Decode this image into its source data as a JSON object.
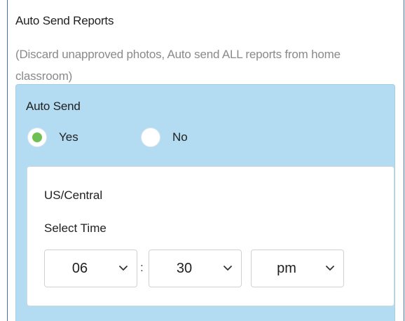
{
  "section": {
    "title": "Auto Send Reports",
    "description": "(Discard unapproved photos, Auto send ALL reports from home classroom)"
  },
  "auto_send": {
    "label": "Auto Send",
    "options": [
      {
        "label": "Yes",
        "selected": true
      },
      {
        "label": "No",
        "selected": false
      }
    ],
    "selected_color": "#6fc054"
  },
  "time": {
    "timezone": "US/Central",
    "label": "Select Time",
    "hour": "06",
    "separator": ":",
    "minute": "30",
    "period": "pm"
  },
  "colors": {
    "panel_background": "#b3dcf2",
    "frame_border": "#3f6fb3"
  },
  "icons": {
    "dropdown": "chevron-down-icon"
  }
}
